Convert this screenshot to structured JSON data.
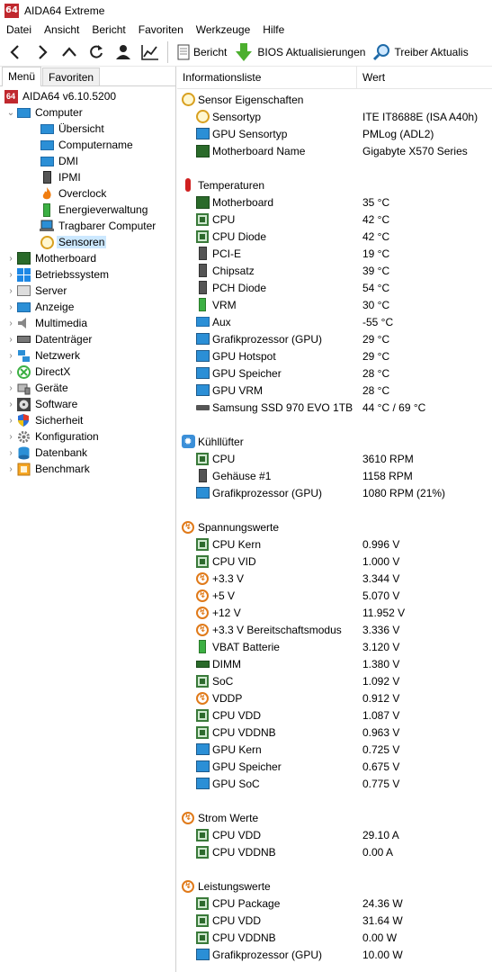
{
  "window": {
    "title": "AIDA64 Extreme",
    "logo_text": "64"
  },
  "menubar": [
    "Datei",
    "Ansicht",
    "Bericht",
    "Favoriten",
    "Werkzeuge",
    "Hilfe"
  ],
  "toolbar": {
    "report_label": "Bericht",
    "bios_label": "BIOS Aktualisierungen",
    "driver_label": "Treiber Aktualis"
  },
  "tabs": {
    "menu": "Menü",
    "favorites": "Favoriten"
  },
  "tree": {
    "root": "AIDA64 v6.10.5200",
    "computer": "Computer",
    "computer_children": [
      "Übersicht",
      "Computername",
      "DMI",
      "IPMI",
      "Overclock",
      "Energieverwaltung",
      "Tragbarer Computer",
      "Sensoren"
    ],
    "items": [
      "Motherboard",
      "Betriebssystem",
      "Server",
      "Anzeige",
      "Multimedia",
      "Datenträger",
      "Netzwerk",
      "DirectX",
      "Geräte",
      "Software",
      "Sicherheit",
      "Konfiguration",
      "Datenbank",
      "Benchmark"
    ]
  },
  "columns": {
    "info": "Informationsliste",
    "value": "Wert"
  },
  "sections": {
    "sensor_props": {
      "title": "Sensor Eigenschaften",
      "rows": [
        {
          "name": "Sensortyp",
          "value": "ITE IT8688E  (ISA A40h)"
        },
        {
          "name": "GPU Sensortyp",
          "value": "PMLog  (ADL2)"
        },
        {
          "name": "Motherboard Name",
          "value": "Gigabyte X570 Series"
        }
      ]
    },
    "temps": {
      "title": "Temperaturen",
      "rows": [
        {
          "name": "Motherboard",
          "value": "35 °C"
        },
        {
          "name": "CPU",
          "value": "42 °C"
        },
        {
          "name": "CPU Diode",
          "value": "42 °C"
        },
        {
          "name": "PCI-E",
          "value": "19 °C"
        },
        {
          "name": "Chipsatz",
          "value": "39 °C"
        },
        {
          "name": "PCH Diode",
          "value": "54 °C"
        },
        {
          "name": "VRM",
          "value": "30 °C"
        },
        {
          "name": "Aux",
          "value": "-55 °C"
        },
        {
          "name": "Grafikprozessor (GPU)",
          "value": "29 °C"
        },
        {
          "name": "GPU Hotspot",
          "value": "29 °C"
        },
        {
          "name": "GPU Speicher",
          "value": "28 °C"
        },
        {
          "name": "GPU VRM",
          "value": "28 °C"
        },
        {
          "name": "Samsung SSD 970 EVO 1TB",
          "value": "44 °C / 69 °C"
        }
      ]
    },
    "fans": {
      "title": "Kühllüfter",
      "rows": [
        {
          "name": "CPU",
          "value": "3610 RPM"
        },
        {
          "name": "Gehäuse #1",
          "value": "1158 RPM"
        },
        {
          "name": "Grafikprozessor (GPU)",
          "value": "1080 RPM  (21%)"
        }
      ]
    },
    "volts": {
      "title": "Spannungswerte",
      "rows": [
        {
          "name": "CPU Kern",
          "value": "0.996 V"
        },
        {
          "name": "CPU VID",
          "value": "1.000 V"
        },
        {
          "name": "+3.3 V",
          "value": "3.344 V"
        },
        {
          "name": "+5 V",
          "value": "5.070 V"
        },
        {
          "name": "+12 V",
          "value": "11.952 V"
        },
        {
          "name": "+3.3 V Bereitschaftsmodus",
          "value": "3.336 V"
        },
        {
          "name": "VBAT Batterie",
          "value": "3.120 V"
        },
        {
          "name": "DIMM",
          "value": "1.380 V"
        },
        {
          "name": "SoC",
          "value": "1.092 V"
        },
        {
          "name": "VDDP",
          "value": "0.912 V"
        },
        {
          "name": "CPU VDD",
          "value": "1.087 V"
        },
        {
          "name": "CPU VDDNB",
          "value": "0.963 V"
        },
        {
          "name": "GPU Kern",
          "value": "0.725 V"
        },
        {
          "name": "GPU Speicher",
          "value": "0.675 V"
        },
        {
          "name": "GPU SoC",
          "value": "0.775 V"
        }
      ]
    },
    "current": {
      "title": "Strom Werte",
      "rows": [
        {
          "name": "CPU VDD",
          "value": "29.10 A"
        },
        {
          "name": "CPU VDDNB",
          "value": "0.00 A"
        }
      ]
    },
    "power": {
      "title": "Leistungswerte",
      "rows": [
        {
          "name": "CPU Package",
          "value": "24.36 W"
        },
        {
          "name": "CPU VDD",
          "value": "31.64 W"
        },
        {
          "name": "CPU VDDNB",
          "value": "0.00 W"
        },
        {
          "name": "Grafikprozessor (GPU)",
          "value": "10.00 W"
        }
      ]
    }
  }
}
